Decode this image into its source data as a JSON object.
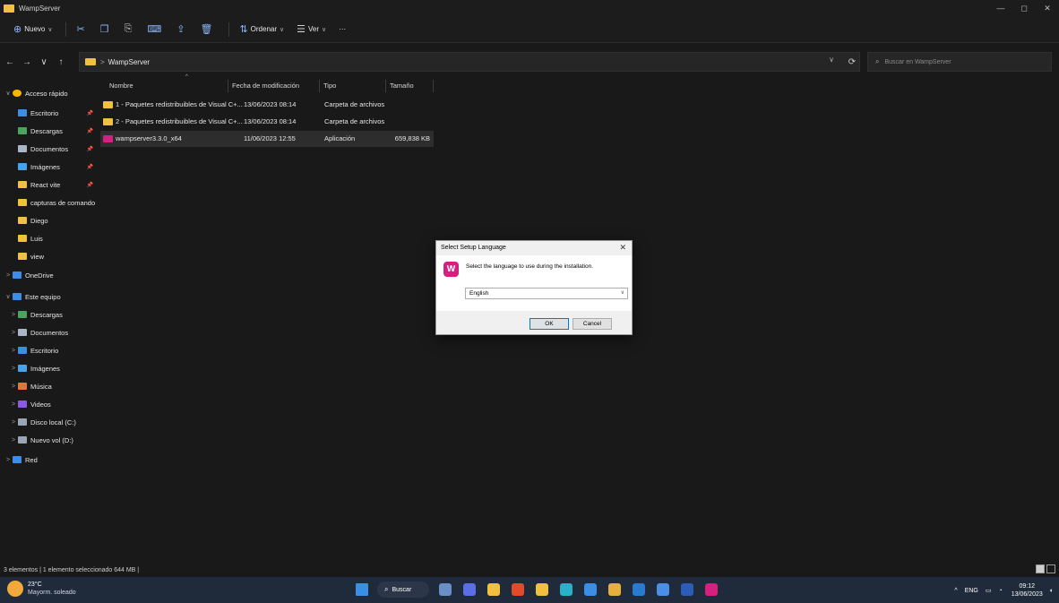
{
  "window": {
    "title": "WampServer",
    "controls": [
      "—",
      "◻",
      "✕"
    ]
  },
  "commandbar": {
    "new_label": "Nuevo",
    "sort_label": "Ordenar",
    "view_label": "Ver",
    "more_label": "···"
  },
  "address": {
    "path": "WampServer",
    "separator": ">"
  },
  "search": {
    "placeholder": "Buscar en WampServer"
  },
  "sidebar": {
    "items": [
      {
        "label": "Acceso rápido",
        "icon": "star-icon",
        "color": "#f5b400",
        "expander": "∨",
        "pinned": false,
        "indent": 0
      },
      {
        "label": "Escritorio",
        "icon": "desktop-icon",
        "color": "#3a8ee6",
        "expander": "",
        "pinned": true,
        "indent": 1
      },
      {
        "label": "Descargas",
        "icon": "download-icon",
        "color": "#4aa35e",
        "expander": "",
        "pinned": true,
        "indent": 1
      },
      {
        "label": "Documentos",
        "icon": "document-icon",
        "color": "#aab6c8",
        "expander": "",
        "pinned": true,
        "indent": 1
      },
      {
        "label": "Imágenes",
        "icon": "image-icon",
        "color": "#4aa3e6",
        "expander": "",
        "pinned": true,
        "indent": 1
      },
      {
        "label": "React vite",
        "icon": "folder-icon",
        "color": "#f0c040",
        "expander": "",
        "pinned": true,
        "indent": 1
      },
      {
        "label": "capturas de comando",
        "icon": "folder-icon",
        "color": "#f0c040",
        "expander": "",
        "pinned": false,
        "indent": 1
      },
      {
        "label": "Diego",
        "icon": "folder-icon",
        "color": "#f0c040",
        "expander": "",
        "pinned": false,
        "indent": 1
      },
      {
        "label": "Luis",
        "icon": "folder-icon",
        "color": "#f0c040",
        "expander": "",
        "pinned": false,
        "indent": 1
      },
      {
        "label": "view",
        "icon": "folder-icon",
        "color": "#f0c040",
        "expander": "",
        "pinned": false,
        "indent": 1
      },
      {
        "label": "OneDrive",
        "icon": "cloud-icon",
        "color": "#3a8ee6",
        "expander": ">",
        "pinned": false,
        "indent": 0
      },
      {
        "label": "Este equipo",
        "icon": "computer-icon",
        "color": "#3a8ee6",
        "expander": "∨",
        "pinned": false,
        "indent": 0
      },
      {
        "label": "Descargas",
        "icon": "download-icon",
        "color": "#4aa35e",
        "expander": ">",
        "pinned": false,
        "indent": 1
      },
      {
        "label": "Documentos",
        "icon": "document-icon",
        "color": "#aab6c8",
        "expander": ">",
        "pinned": false,
        "indent": 1
      },
      {
        "label": "Escritorio",
        "icon": "desktop-icon",
        "color": "#3a8ee6",
        "expander": ">",
        "pinned": false,
        "indent": 1
      },
      {
        "label": "Imágenes",
        "icon": "image-icon",
        "color": "#4aa3e6",
        "expander": ">",
        "pinned": false,
        "indent": 1
      },
      {
        "label": "Música",
        "icon": "music-icon",
        "color": "#e6733a",
        "expander": ">",
        "pinned": false,
        "indent": 1
      },
      {
        "label": "Videos",
        "icon": "video-icon",
        "color": "#8a5ae6",
        "expander": ">",
        "pinned": false,
        "indent": 1
      },
      {
        "label": "Disco local (C:)",
        "icon": "drive-icon",
        "color": "#9aa6b5",
        "expander": ">",
        "pinned": false,
        "indent": 1
      },
      {
        "label": "Nuevo vol (D:)",
        "icon": "drive-icon",
        "color": "#9aa6b5",
        "expander": ">",
        "pinned": false,
        "indent": 1
      },
      {
        "label": "Red",
        "icon": "network-icon",
        "color": "#3a8ee6",
        "expander": ">",
        "pinned": false,
        "indent": 0
      }
    ]
  },
  "columns": {
    "name": "Nombre",
    "modified": "Fecha de modificación",
    "type": "Tipo",
    "size": "Tamaño"
  },
  "files": [
    {
      "name": "1 - Paquetes redistribuibles de Visual C+...",
      "modified": "13/06/2023 08:14",
      "type": "Carpeta de archivos",
      "size": "",
      "icon": "folder-icon",
      "color": "#f0c040",
      "selected": false
    },
    {
      "name": "2 - Paquetes redistribuibles de Visual C+...",
      "modified": "13/06/2023 08:14",
      "type": "Carpeta de archivos",
      "size": "",
      "icon": "folder-icon",
      "color": "#f0c040",
      "selected": false
    },
    {
      "name": "wampserver3.3.0_x64",
      "modified": "11/06/2023 12:55",
      "type": "Aplicación",
      "size": "659,838 KB",
      "icon": "wamp-app-icon",
      "color": "#d61f7e",
      "selected": true
    }
  ],
  "status": {
    "text": "3 elementos  |  1 elemento seleccionado 644 MB  |"
  },
  "dialog": {
    "title": "Select Setup Language",
    "message": "Select the language to use during the installation.",
    "selected_language": "English",
    "ok_label": "OK",
    "cancel_label": "Cancel",
    "logo_text": "W"
  },
  "taskbar": {
    "temp": "23°C",
    "weather": "Mayorm. soleado",
    "search_label": "Buscar",
    "lang": "ENG",
    "time": "09:12",
    "date": "13/06/2023",
    "apps": [
      {
        "name": "start-button",
        "color": "#3a8ee6"
      },
      {
        "name": "file-manager-taskbar-icon",
        "color": "#6a8fc8"
      },
      {
        "name": "chat-taskbar-icon",
        "color": "#5a6ee6"
      },
      {
        "name": "calendar-taskbar-icon",
        "color": "#f0c040"
      },
      {
        "name": "brave-taskbar-icon",
        "color": "#e24a2a"
      },
      {
        "name": "explorer-taskbar-icon",
        "color": "#f0c040"
      },
      {
        "name": "edge-taskbar-icon",
        "color": "#2ab0c8"
      },
      {
        "name": "vpn-taskbar-icon",
        "color": "#3a8ee6"
      },
      {
        "name": "chrome-taskbar-icon",
        "color": "#e6b03a"
      },
      {
        "name": "vscode-taskbar-icon",
        "color": "#2a7ad0"
      },
      {
        "name": "store-taskbar-icon",
        "color": "#4a8ee6"
      },
      {
        "name": "word-taskbar-icon",
        "color": "#2b5db8"
      },
      {
        "name": "wamp-taskbar-icon",
        "color": "#d61f7e"
      }
    ]
  }
}
